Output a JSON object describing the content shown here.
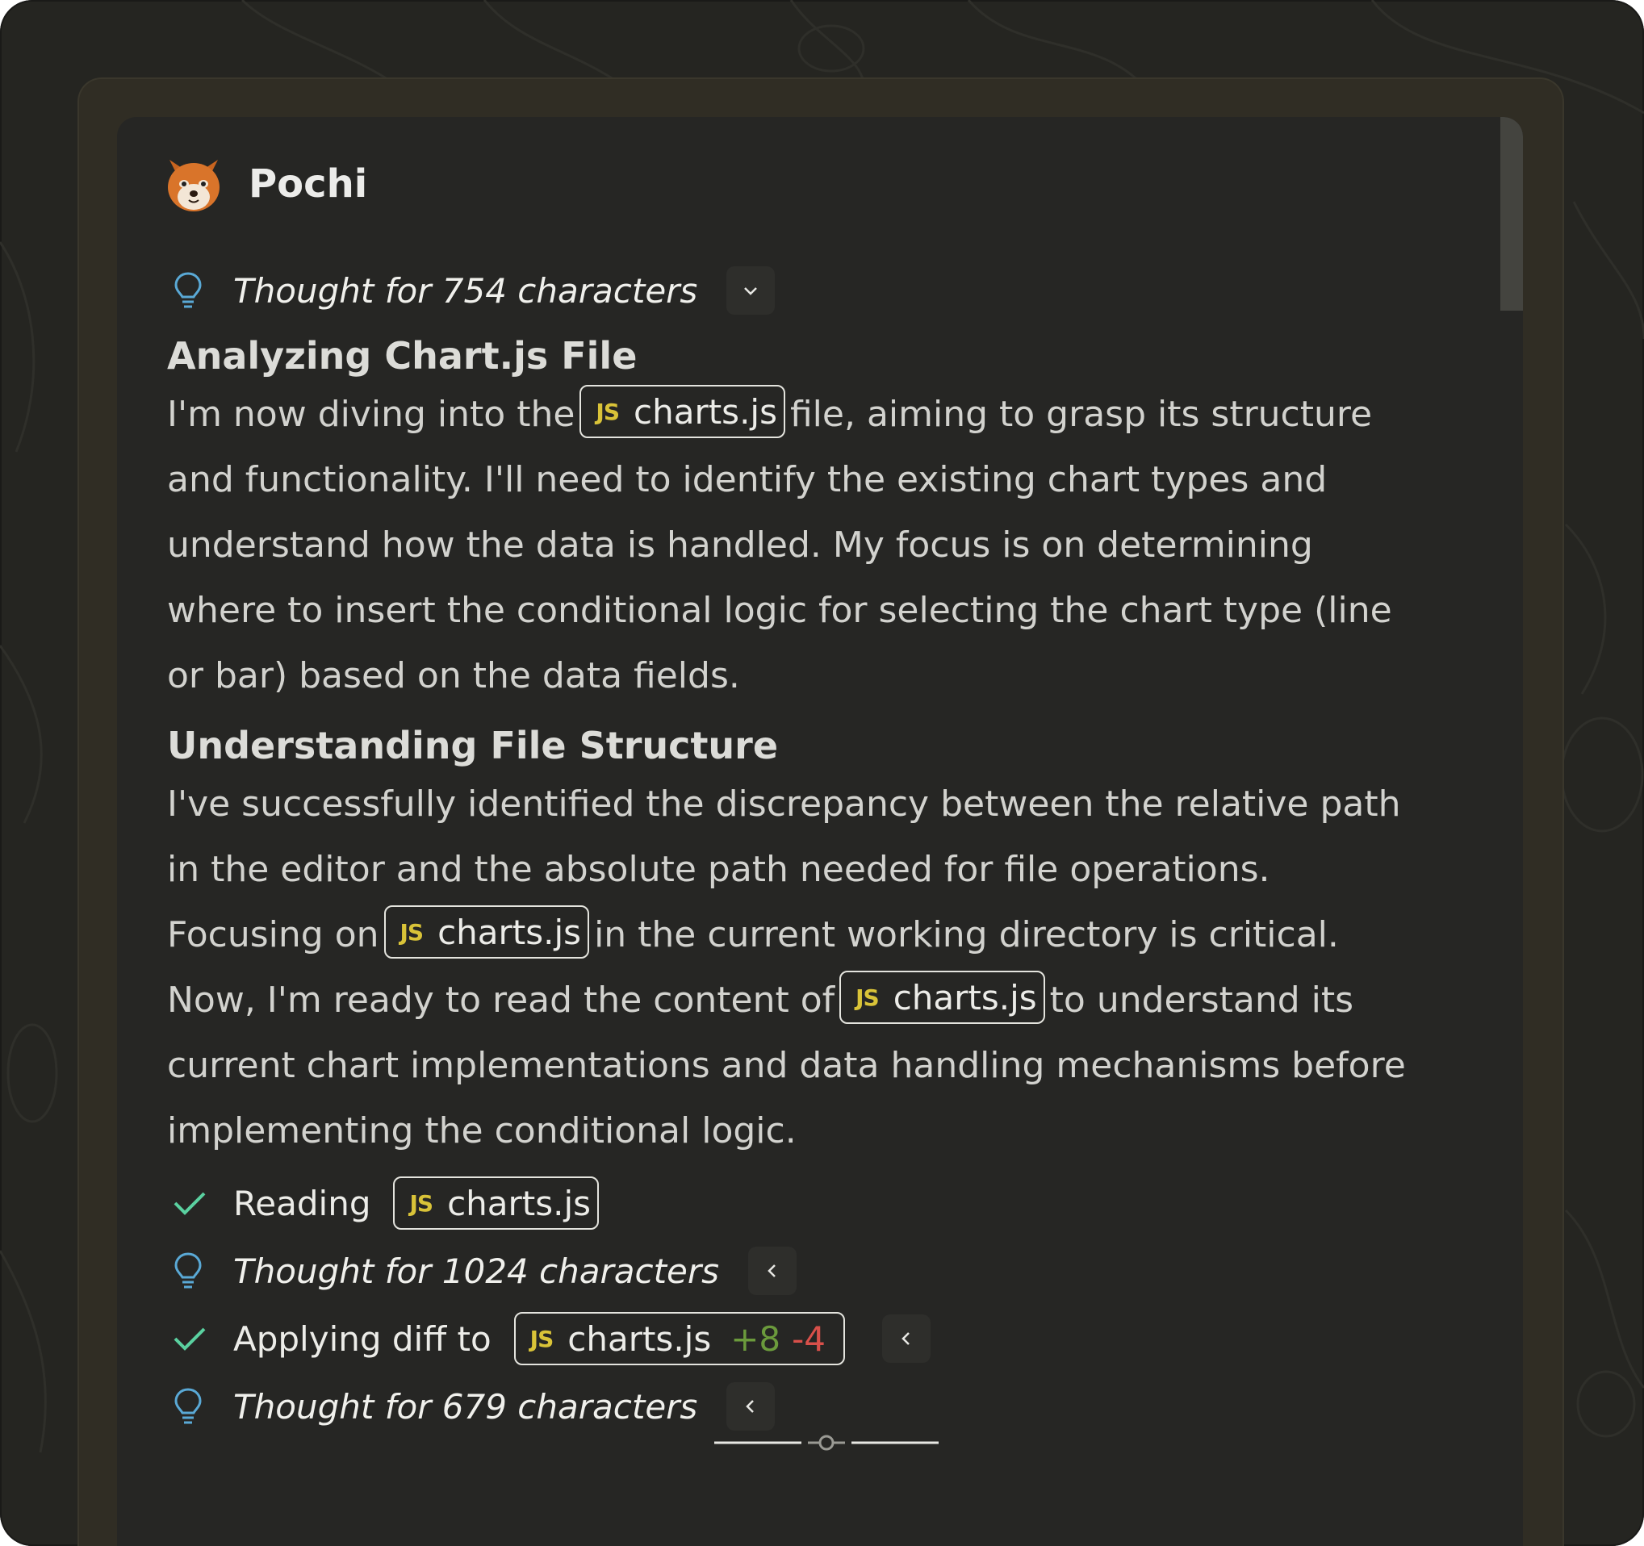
{
  "header": {
    "app_name": "Pochi",
    "avatar_icon": "shiba-dog-avatar"
  },
  "thought_1": {
    "label": "Thought for 754 characters",
    "toggle": "chevron-down"
  },
  "section_1": {
    "title": "Analyzing Chart.js File",
    "l1_before": "I'm now diving into the",
    "l1_after": "file, aiming to grasp its structure",
    "l2": "and functionality. I'll need to identify the existing chart types and",
    "l3": "understand how the data is handled. My focus is on determining",
    "l4": "where to insert the conditional logic for selecting the chart type (line",
    "l5": "or bar) based on the data fields."
  },
  "section_2": {
    "title": "Understanding File Structure",
    "l1": "I've successfully identified the discrepancy between the relative path",
    "l2": "in the editor and the absolute path needed for file operations.",
    "l3_before": "Focusing on",
    "l3_after": "in the current working directory is critical.",
    "l4_before": "Now, I'm ready to read the content of",
    "l4_after": "to understand its",
    "l5": "current chart implementations and data handling mechanisms before",
    "l6": "implementing the conditional logic."
  },
  "file_chip": {
    "badge": "JS",
    "name": "charts.js"
  },
  "tool_reading": {
    "label": "Reading"
  },
  "thought_2": {
    "label": "Thought for 1024 characters",
    "toggle": "chevron-left"
  },
  "tool_diff": {
    "label": "Applying diff to",
    "added": "+8",
    "removed": "-4"
  },
  "thought_3": {
    "label": "Thought for 679 characters",
    "toggle": "chevron-left"
  },
  "colors": {
    "background": "#252521",
    "panel": "#262624",
    "accent_check": "#5ad1a0",
    "bulb": "#5aa9d6",
    "js_badge": "#d9c338",
    "added": "#6b9a3c",
    "removed": "#d9504a"
  }
}
